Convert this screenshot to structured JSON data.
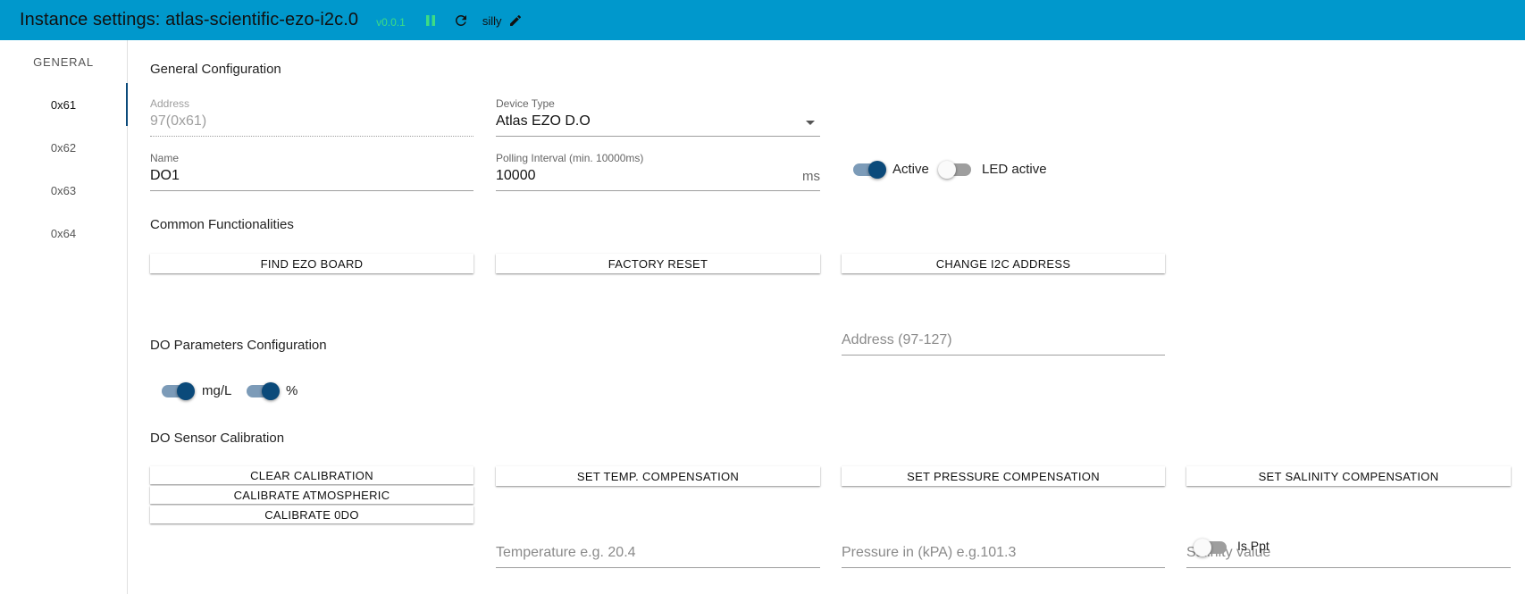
{
  "header": {
    "title": "Instance settings: atlas-scientific-ezo-i2c.0",
    "version": "v0.0.1",
    "log_level": "silly",
    "icons": [
      "pause-icon",
      "refresh-icon",
      "pencil-icon"
    ],
    "colors": {
      "bar": "#0098cc",
      "version": "#3ddc84",
      "pause": "#3ddc84"
    }
  },
  "sidebar": {
    "tabs": [
      {
        "label": "GENERAL",
        "active": false
      },
      {
        "label": "0x61",
        "active": true
      },
      {
        "label": "0x62",
        "active": false
      },
      {
        "label": "0x63",
        "active": false
      },
      {
        "label": "0x64",
        "active": false
      }
    ]
  },
  "general": {
    "title": "General Configuration",
    "address": {
      "label": "Address",
      "value": "97(0x61)"
    },
    "device_type": {
      "label": "Device Type",
      "value": "Atlas EZO D.O"
    },
    "name": {
      "label": "Name",
      "value": "DO1"
    },
    "polling": {
      "label": "Polling Interval (min. 10000ms)",
      "value": "10000",
      "suffix": "ms"
    },
    "active": {
      "label": "Active",
      "on": true
    },
    "led_active": {
      "label": "LED active",
      "on": false
    }
  },
  "common": {
    "title": "Common Functionalities",
    "find_button": "FIND EZO BOARD",
    "reset_button": "FACTORY RESET",
    "change_button": "CHANGE I2C ADDRESS",
    "address_placeholder": "Address (97-127)"
  },
  "do_params": {
    "title": "DO Parameters Configuration",
    "mgl": {
      "label": "mg/L",
      "on": true
    },
    "percent": {
      "label": "%",
      "on": true
    }
  },
  "calibration": {
    "title": "DO Sensor Calibration",
    "clear_button": "CLEAR CALIBRATION",
    "atmospheric_button": "CALIBRATE ATMOSPHERIC",
    "zero_button": "CALIBRATE 0DO",
    "temp_button": "SET TEMP. COMPENSATION",
    "temp_placeholder": "Temperature e.g. 20.4",
    "pressure_button": "SET PRESSURE COMPENSATION",
    "pressure_placeholder": "Pressure in (kPA) e.g.101.3",
    "salinity_button": "SET SALINITY COMPENSATION",
    "salinity_placeholder": "Salinity value",
    "is_ppt": {
      "label": "Is Ppt",
      "on": false
    }
  }
}
